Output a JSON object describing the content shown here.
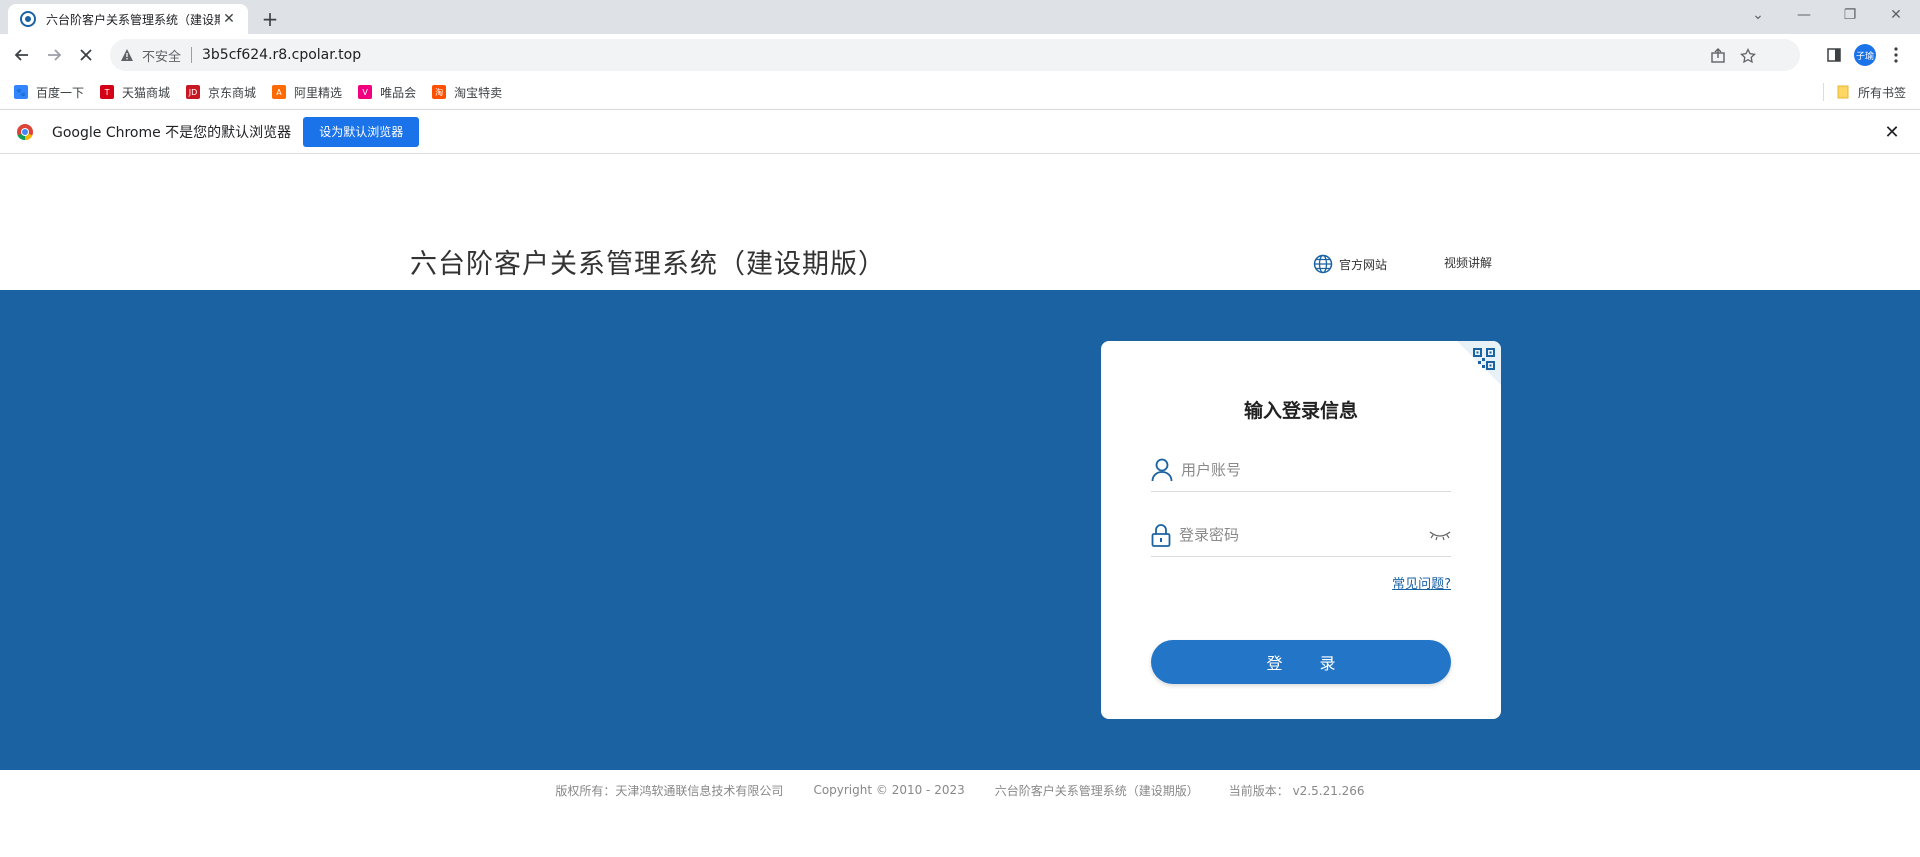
{
  "browser": {
    "tab_title": "六台阶客户关系管理系统（建设期版）",
    "security_label": "不安全",
    "url": "3b5cf624.r8.cpolar.top",
    "profile_initials": "子瑜"
  },
  "bookmarks": {
    "items": [
      {
        "label": "百度一下",
        "icon_color": "#3385ff",
        "icon": "baidu-paw-icon",
        "glyph": "🐾"
      },
      {
        "label": "天猫商城",
        "icon_color": "#d40016",
        "icon": "tmall-icon",
        "glyph": "T"
      },
      {
        "label": "京东商城",
        "icon_color": "#c91623",
        "icon": "jd-icon",
        "glyph": "JD"
      },
      {
        "label": "阿里精选",
        "icon_color": "#ff6a00",
        "icon": "aliexpress-icon",
        "glyph": "A"
      },
      {
        "label": "唯品会",
        "icon_color": "#f10180",
        "icon": "vip-icon",
        "glyph": "V"
      },
      {
        "label": "淘宝特卖",
        "icon_color": "#ff5000",
        "icon": "taobao-icon",
        "glyph": "淘"
      }
    ],
    "all_bookmarks": "所有书签"
  },
  "infobar": {
    "message": "Google Chrome 不是您的默认浏览器",
    "button": "设为默认浏览器"
  },
  "header": {
    "title": "六台阶客户关系管理系统（建设期版）",
    "official_site": "官方网站",
    "video_tutorial": "视频讲解"
  },
  "login": {
    "title": "输入登录信息",
    "username_placeholder": "用户账号",
    "password_placeholder": "登录密码",
    "faq": "常见问题?",
    "submit": "登 录"
  },
  "footer": {
    "copyright_owner": "版权所有：天津鸿软通联信息技术有限公司",
    "copyright_years": "Copyright © 2010 - 2023",
    "system_name": "六台阶客户关系管理系统（建设期版）",
    "version": "当前版本：  v2.5.21.266"
  },
  "colors": {
    "brand_blue": "#1b62a3",
    "button_blue": "#2376c7",
    "chrome_blue": "#1a73e8"
  }
}
